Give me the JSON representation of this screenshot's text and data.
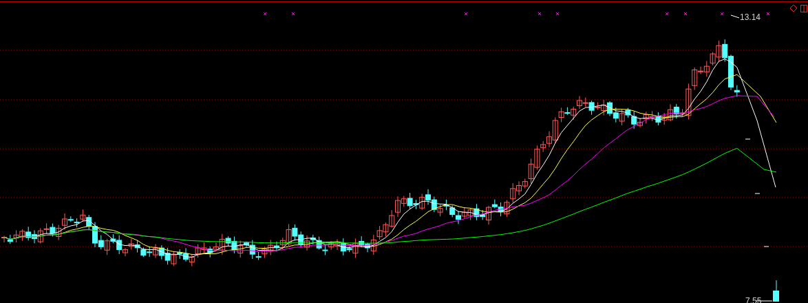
{
  "chart": {
    "high_label": "13.14",
    "low_label": "7.55"
  }
}
